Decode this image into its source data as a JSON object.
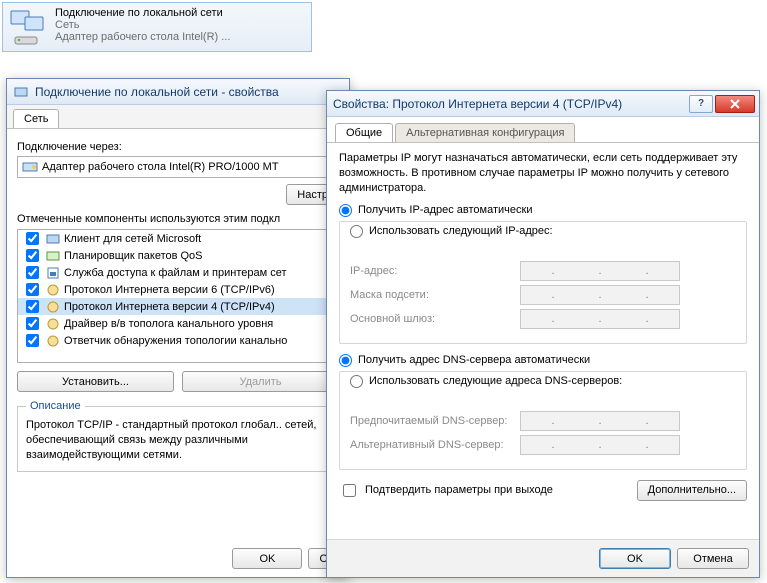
{
  "banner": {
    "title": "Подключение по локальной сети",
    "sub1": "Сеть",
    "sub2": "Адаптер рабочего стола Intel(R) ..."
  },
  "props": {
    "title": "Подключение по локальной сети - свойства",
    "tab_net": "Сеть",
    "connect_via_label": "Подключение через:",
    "adapter_name": "Адаптер рабочего стола Intel(R) PRO/1000 MT",
    "configure_btn": "Настр",
    "components_label": "Отмеченные компоненты используются этим подкл",
    "components": [
      "Клиент для сетей Microsoft",
      "Планировщик пакетов QoS",
      "Служба доступа к файлам и принтерам сет",
      "Протокол Интернета версии 6 (TCP/IPv6)",
      "Протокол Интернета версии 4 (TCP/IPv4)",
      "Драйвер в/в тополога канального уровня",
      "Ответчик обнаружения топологии канально"
    ],
    "install_btn": "Установить...",
    "uninstall_btn": "Удалить",
    "desc_legend": "Описание",
    "desc_text": "Протокол TCP/IP - стандартный протокол глобал.. сетей, обеспечивающий связь между различными взаимодействующими сетями.",
    "ok_btn": "OK",
    "cancel_btn": "О"
  },
  "ip": {
    "title": "Свойства: Протокол Интернета версии 4 (TCP/IPv4)",
    "tab_general": "Общие",
    "tab_alt": "Альтернативная конфигурация",
    "info": "Параметры IP могут назначаться автоматически, если сеть поддерживает эту возможность. В противном случае параметры IP можно получить у сетевого администратора.",
    "radio_ip_auto": "Получить IP-адрес автоматически",
    "radio_ip_manual": "Использовать следующий IP-адрес:",
    "lbl_ip": "IP-адрес:",
    "lbl_mask": "Маска подсети:",
    "lbl_gw": "Основной шлюз:",
    "radio_dns_auto": "Получить адрес DNS-сервера автоматически",
    "radio_dns_manual": "Использовать следующие адреса DNS-серверов:",
    "lbl_dns1": "Предпочитаемый DNS-сервер:",
    "lbl_dns2": "Альтернативный DNS-сервер:",
    "chk_validate": "Подтвердить параметры при выходе",
    "advanced_btn": "Дополнительно...",
    "ok_btn": "OK",
    "cancel_btn": "Отмена"
  }
}
